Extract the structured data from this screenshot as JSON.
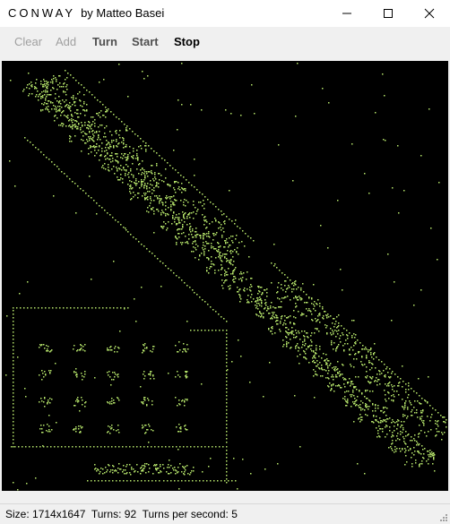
{
  "window": {
    "title": "CONWAY",
    "subtitle": "by Matteo Basei",
    "minimize_icon": "minimize-icon",
    "maximize_icon": "maximize-icon",
    "close_icon": "close-icon"
  },
  "toolbar": {
    "clear_label": "Clear",
    "add_label": "Add",
    "turn_label": "Turn",
    "start_label": "Start",
    "stop_label": "Stop",
    "clear_enabled": false,
    "add_enabled": false
  },
  "board": {
    "background": "#000000",
    "cell_color": "#b5e36a"
  },
  "status": {
    "size_label": "Size:",
    "size_value": "1714x1647",
    "turns_label": "Turns:",
    "turns_value": "92",
    "tps_label": "Turns per second:",
    "tps_value": "5"
  }
}
